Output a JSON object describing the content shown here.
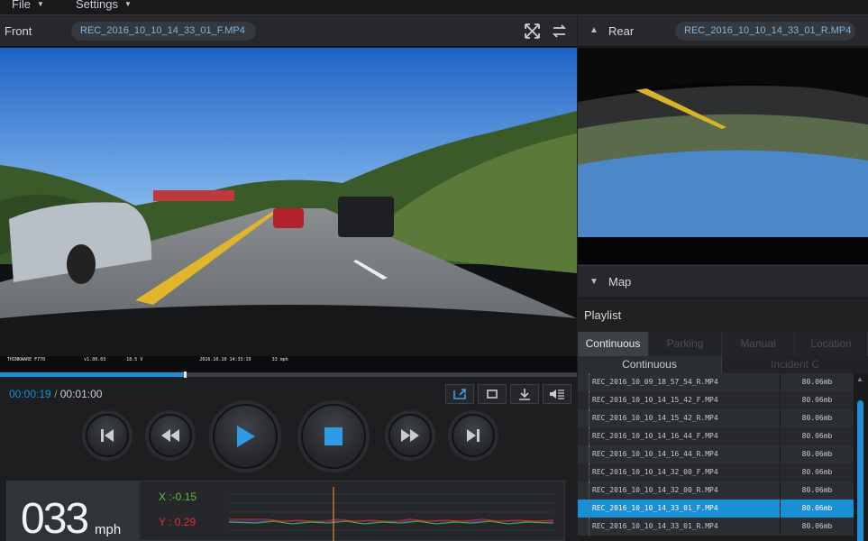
{
  "menu": {
    "file": "File",
    "settings": "Settings"
  },
  "front": {
    "label": "Front",
    "filename": "REC_2016_10_10_14_33_01_F.MP4",
    "overlay": [
      "THINKWARE F770",
      "v1.00.03",
      "18.5 V",
      "2016.10.10 14:33:19",
      "33 mph"
    ]
  },
  "rear": {
    "label": "Rear",
    "filename": "REC_2016_10_10_14_33_01_R.MP4"
  },
  "map": {
    "label": "Map"
  },
  "playlist": {
    "label": "Playlist",
    "tabs": [
      "Continuous",
      "Parking",
      "Manual",
      "Location"
    ],
    "subtabs": [
      "Continuous",
      "Incident C"
    ],
    "files": [
      {
        "name": "REC_2016_10_09_18_57_54_R.MP4",
        "size": "80.06mb"
      },
      {
        "name": "REC_2016_10_10_14_15_42_F.MP4",
        "size": "80.06mb"
      },
      {
        "name": "REC_2016_10_10_14_15_42_R.MP4",
        "size": "80.06mb"
      },
      {
        "name": "REC_2016_10_10_14_16_44_F.MP4",
        "size": "80.06mb"
      },
      {
        "name": "REC_2016_10_10_14_16_44_R.MP4",
        "size": "80.06mb"
      },
      {
        "name": "REC_2016_10_10_14_32_00_F.MP4",
        "size": "80.06mb"
      },
      {
        "name": "REC_2016_10_10_14_32_00_R.MP4",
        "size": "80.06mb"
      },
      {
        "name": "REC_2016_10_10_14_33_01_F.MP4",
        "size": "80.06mb",
        "selected": true
      },
      {
        "name": "REC_2016_10_10_14_33_01_R.MP4",
        "size": "80.06mb"
      }
    ]
  },
  "playback": {
    "current": "00:00:19",
    "separator": "/",
    "total": "00:01:00",
    "progress": 0.32
  },
  "speed": {
    "value": "033",
    "unit": "mph"
  },
  "gsensor": {
    "x": "X :-0.15",
    "y": "Y : 0.29"
  },
  "colors": {
    "accent": "#1a8fd6",
    "x_color": "#5fbf3a",
    "y_color": "#d9332e"
  }
}
